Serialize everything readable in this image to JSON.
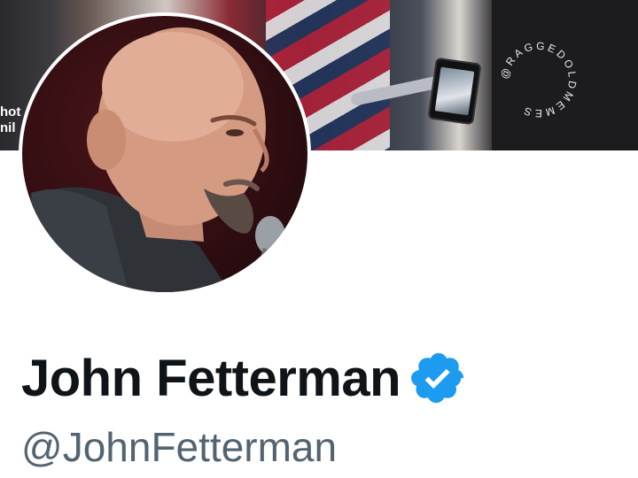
{
  "banner": {
    "overlay_text_line1": "hot",
    "overlay_text_line2": "nil",
    "watermark": "@RAGGEDOLDMEMES"
  },
  "profile": {
    "display_name": "John Fetterman",
    "handle": "@JohnFetterman",
    "verified": true,
    "verified_color": "#1d9bf0"
  },
  "icons": {
    "verified_badge": "verified-badge-icon"
  }
}
